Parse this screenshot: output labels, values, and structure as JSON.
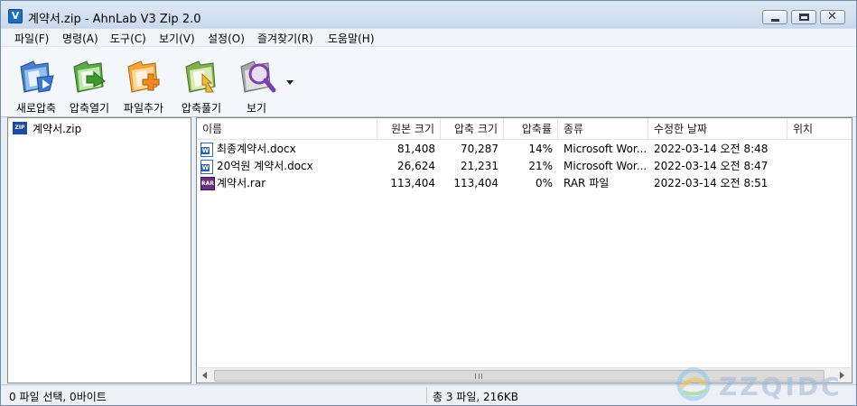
{
  "window": {
    "title": "계약서.zip - AhnLab V3 Zip 2.0",
    "app_icon_glyph": "V"
  },
  "menu": [
    "파일(F)",
    "명령(A)",
    "도구(C)",
    "보기(V)",
    "설정(O)",
    "즐겨찾기(R)",
    "도움말(H)"
  ],
  "toolbar": {
    "buttons": [
      {
        "label": "새로압축",
        "icon": "new-compress-icon"
      },
      {
        "label": "압축열기",
        "icon": "open-archive-icon"
      },
      {
        "label": "파일추가",
        "icon": "add-file-icon"
      },
      {
        "label": "압축풀기",
        "icon": "extract-icon"
      },
      {
        "label": "보기",
        "icon": "view-magnifier-icon"
      }
    ]
  },
  "tree": {
    "root": {
      "label": "계약서.zip",
      "icon": "zip-icon",
      "icon_text": "ZIP"
    }
  },
  "list": {
    "columns": [
      "이름",
      "원본 크기",
      "압축 크기",
      "압축률",
      "종류",
      "수정한 날짜",
      "위치"
    ],
    "rows": [
      {
        "name": "최종계약서.docx",
        "original": "81,408",
        "compressed": "70,287",
        "ratio": "14%",
        "type": "Microsoft Wor...",
        "modified": "2022-03-14 오전 8:48",
        "location": "",
        "icon": "word-document-icon"
      },
      {
        "name": "20억원 계약서.docx",
        "original": "26,624",
        "compressed": "21,231",
        "ratio": "21%",
        "type": "Microsoft Wor...",
        "modified": "2022-03-14 오전 8:47",
        "location": "",
        "icon": "word-document-icon"
      },
      {
        "name": "계약서.rar",
        "original": "113,404",
        "compressed": "113,404",
        "ratio": "0%",
        "type": "RAR 파일",
        "modified": "2022-03-14 오전 8:51",
        "location": "",
        "icon": "rar-archive-icon"
      }
    ]
  },
  "status": {
    "selection": "0 파일 선택, 0바이트",
    "total": "총 3 파일, 216KB"
  },
  "watermark": {
    "text": "ZZQIDC"
  }
}
